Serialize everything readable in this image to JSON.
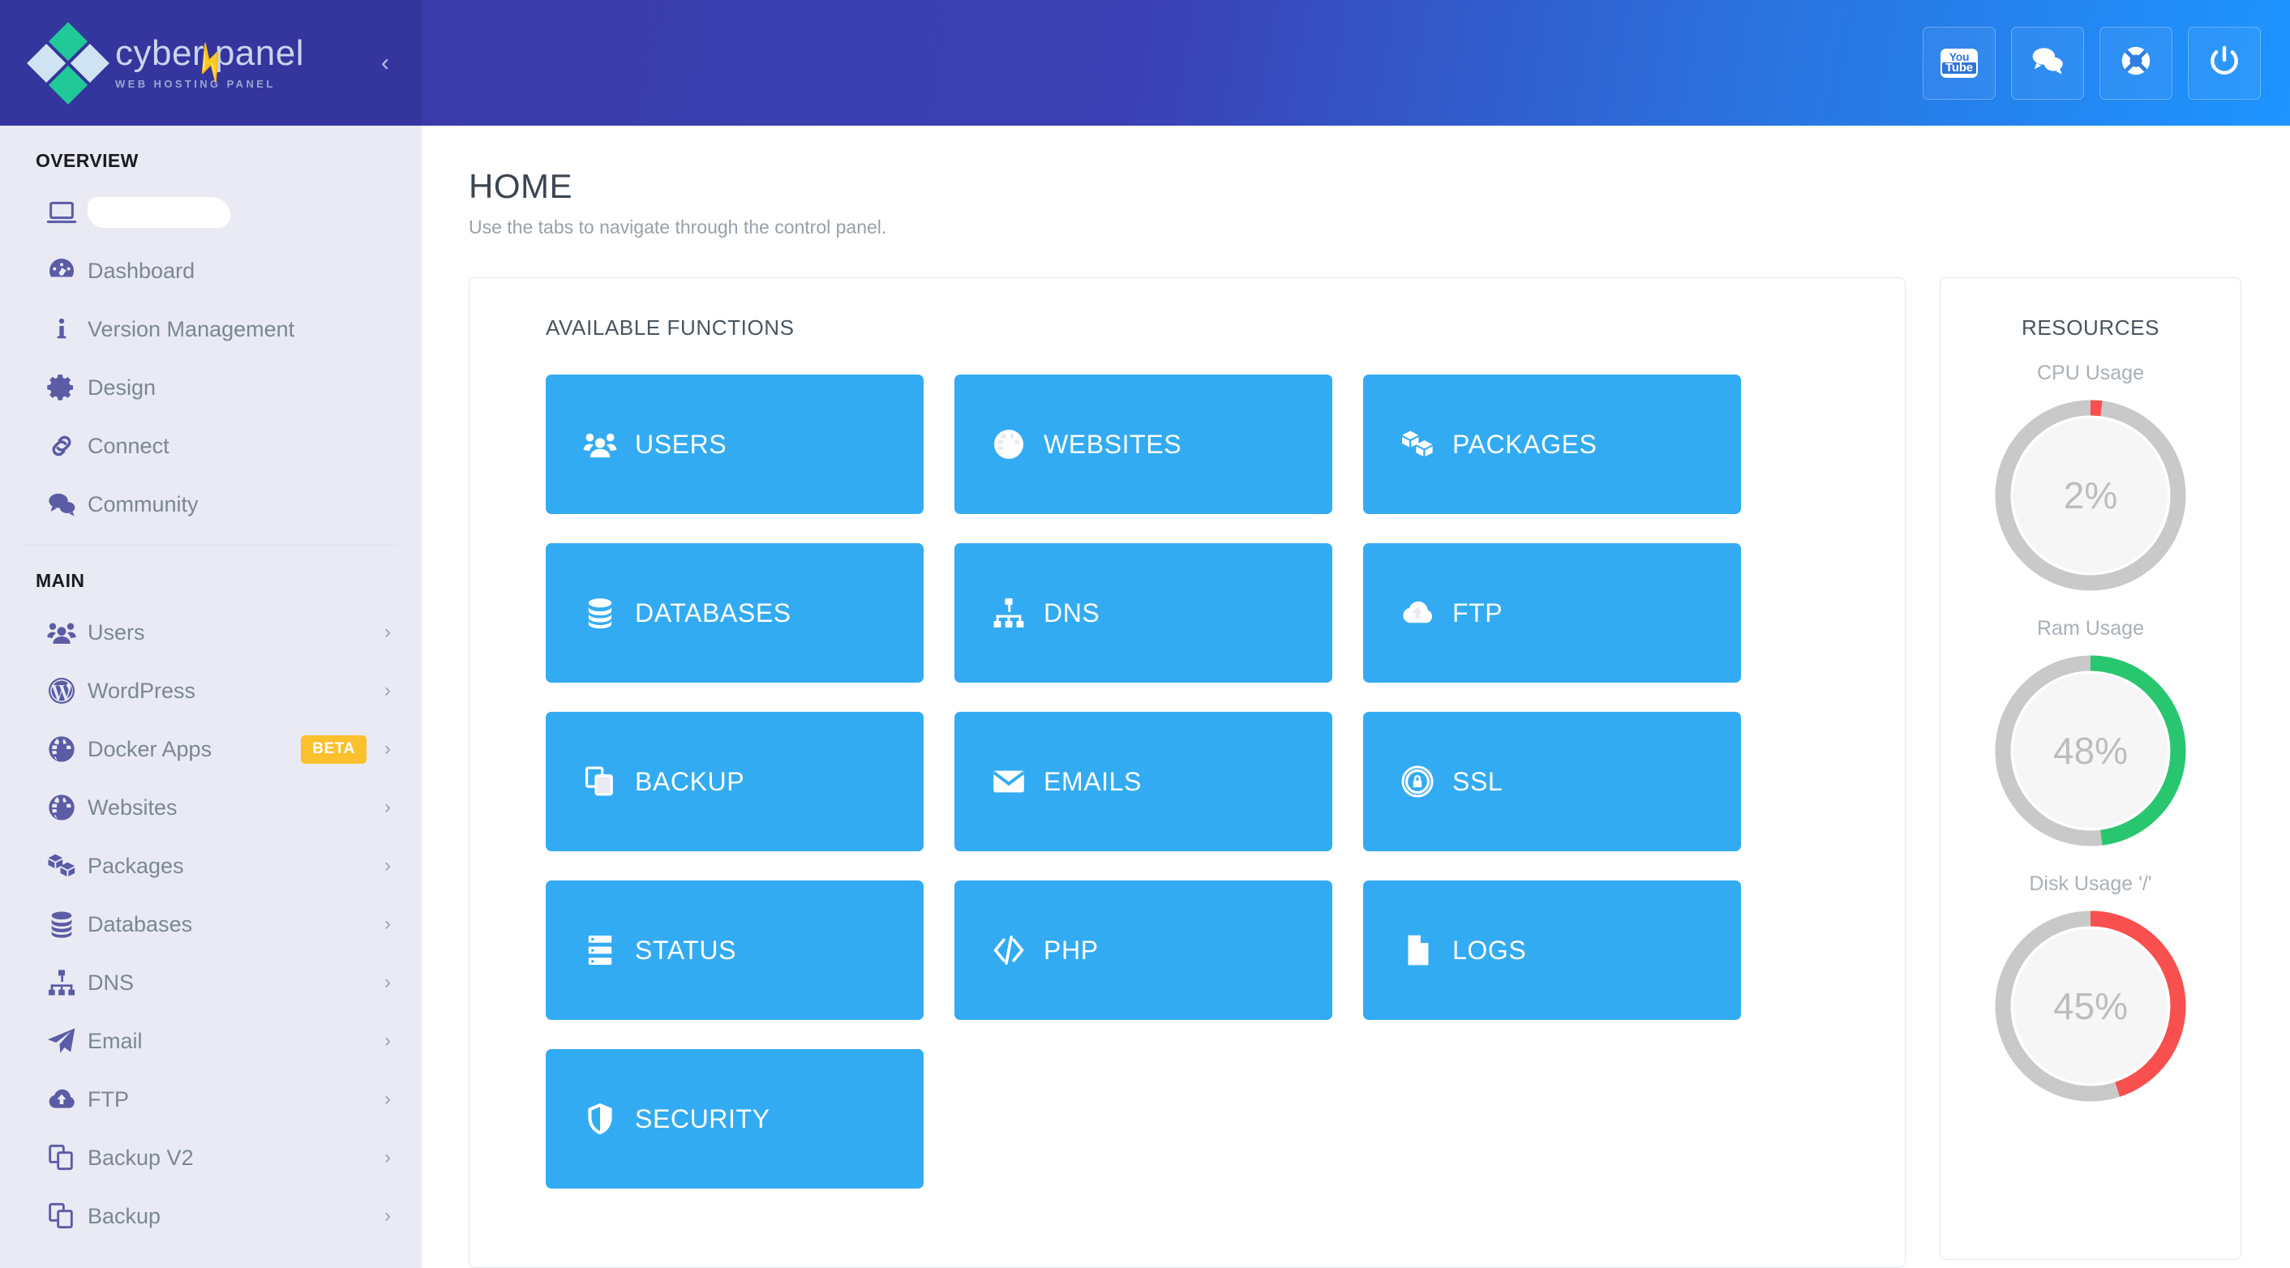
{
  "brand": {
    "title": "cyber panel",
    "subtitle": "WEB HOSTING PANEL",
    "bolt_glyph": "⚡",
    "collapse_glyph": "‹"
  },
  "topbar": {
    "buttons": [
      {
        "name": "youtube-button",
        "icon": "youtube-icon",
        "you": "You",
        "tube": "Tube"
      },
      {
        "name": "chat-button",
        "icon": "comments-icon"
      },
      {
        "name": "support-button",
        "icon": "life-ring-icon"
      },
      {
        "name": "logout-button",
        "icon": "power-icon"
      }
    ]
  },
  "sidebar": {
    "sections": [
      {
        "title": "OVERVIEW",
        "items": [
          {
            "label": "",
            "icon": "laptop-icon",
            "redacted": true,
            "chevron": false
          },
          {
            "label": "Dashboard",
            "icon": "dashboard-icon",
            "chevron": false
          },
          {
            "label": "Version Management",
            "icon": "info-icon",
            "chevron": false
          },
          {
            "label": "Design",
            "icon": "gear-icon",
            "chevron": false
          },
          {
            "label": "Connect",
            "icon": "link-icon",
            "chevron": false
          },
          {
            "label": "Community",
            "icon": "comments-icon",
            "chevron": false
          }
        ]
      },
      {
        "title": "MAIN",
        "items": [
          {
            "label": "Users",
            "icon": "users-icon",
            "chevron": true
          },
          {
            "label": "WordPress",
            "icon": "wordpress-icon",
            "chevron": true
          },
          {
            "label": "Docker Apps",
            "icon": "globe-icon",
            "chevron": true,
            "badge": "BETA"
          },
          {
            "label": "Websites",
            "icon": "globe-icon",
            "chevron": true
          },
          {
            "label": "Packages",
            "icon": "packages-icon",
            "chevron": true
          },
          {
            "label": "Databases",
            "icon": "database-icon",
            "chevron": true
          },
          {
            "label": "DNS",
            "icon": "sitemap-icon",
            "chevron": true
          },
          {
            "label": "Email",
            "icon": "paper-plane-icon",
            "chevron": true
          },
          {
            "label": "FTP",
            "icon": "cloud-upload-icon",
            "chevron": true
          },
          {
            "label": "Backup V2",
            "icon": "copy-icon",
            "chevron": true
          },
          {
            "label": "Backup",
            "icon": "copy-icon",
            "chevron": true
          }
        ]
      }
    ]
  },
  "page": {
    "title": "HOME",
    "subtitle": "Use the tabs to navigate through the control panel."
  },
  "functions": {
    "heading": "AVAILABLE FUNCTIONS",
    "tiles": [
      {
        "label": "USERS",
        "icon": "users-icon"
      },
      {
        "label": "WEBSITES",
        "icon": "globe-icon"
      },
      {
        "label": "PACKAGES",
        "icon": "packages-icon"
      },
      {
        "label": "DATABASES",
        "icon": "database-icon"
      },
      {
        "label": "DNS",
        "icon": "sitemap-icon"
      },
      {
        "label": "FTP",
        "icon": "cloud-upload-icon"
      },
      {
        "label": "BACKUP",
        "icon": "copy-icon"
      },
      {
        "label": "EMAILS",
        "icon": "envelope-icon"
      },
      {
        "label": "SSL",
        "icon": "lock-circle-icon"
      },
      {
        "label": "STATUS",
        "icon": "server-icon"
      },
      {
        "label": "PHP",
        "icon": "code-icon"
      },
      {
        "label": "LOGS",
        "icon": "file-icon"
      },
      {
        "label": "SECURITY",
        "icon": "shield-icon"
      }
    ]
  },
  "resources": {
    "heading": "RESOURCES",
    "gauges": [
      {
        "label": "CPU Usage",
        "value": 2,
        "display": "2%",
        "color": "#f8504e"
      },
      {
        "label": "Ram Usage",
        "value": 48,
        "display": "48%",
        "color": "#28c76f"
      },
      {
        "label": "Disk Usage '/'",
        "value": 45,
        "display": "45%",
        "color": "#f8504e"
      }
    ],
    "track_color": "#c9c9c9",
    "fill_color": "#f6f6f6"
  },
  "colors": {
    "sidebar_bg": "#e9eaf3",
    "logo_bg": "#35359e",
    "tile_blue": "#33abf2",
    "badge_amber": "#fbc02d",
    "header_from": "#3a3ba8",
    "header_to": "#1e95ff"
  }
}
